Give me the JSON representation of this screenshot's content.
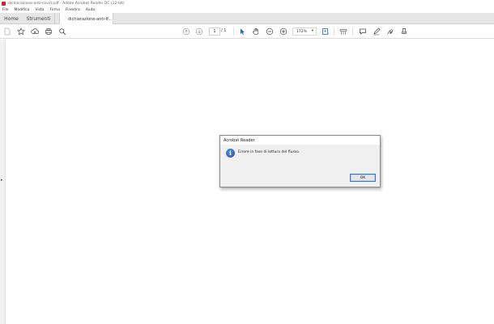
{
  "window": {
    "title": "dichiarazione-anti-covid.pdf - Adobe Acrobat Reader DC (32-bit)"
  },
  "menu": {
    "items": [
      "File",
      "Modifica",
      "Vista",
      "Firma",
      "Finestra",
      "Aiuto"
    ]
  },
  "tabs": {
    "home": "Home",
    "tools": "Strumenti",
    "document": "dichiarazione-anti-c...",
    "close": "×"
  },
  "toolbar": {
    "page_current": "1",
    "page_total": "/ 1",
    "zoom": "172%",
    "icons": [
      "new-file-icon",
      "bookmark-star-icon",
      "cloud-upload-icon",
      "print-icon",
      "search-icon",
      "page-up-icon",
      "page-down-icon",
      "select-cursor-icon",
      "hand-icon",
      "zoom-out-icon",
      "zoom-in-icon",
      "fit-page-icon",
      "scroll-mode-icon",
      "comment-icon",
      "pen-icon",
      "sign-icon",
      "stamp-icon"
    ]
  },
  "dialog": {
    "title": "Acrobat Reader",
    "message": "Errore in fase di lettura del flusso.",
    "ok": "OK",
    "icon": "info-icon"
  },
  "colors": {
    "accent": "#1a6dd4",
    "app_red": "#d1232a",
    "tab_bg": "#e6e6e6"
  }
}
